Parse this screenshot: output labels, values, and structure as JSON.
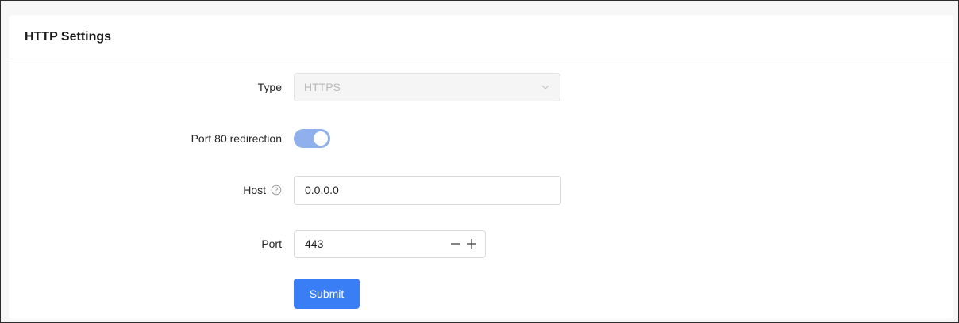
{
  "card": {
    "title": "HTTP Settings"
  },
  "form": {
    "type": {
      "label": "Type",
      "value": "HTTPS",
      "disabled": true
    },
    "redirection": {
      "label": "Port 80 redirection",
      "enabled": true
    },
    "host": {
      "label": "Host",
      "value": "0.0.0.0",
      "help_icon": "question-circle-icon"
    },
    "port": {
      "label": "Port",
      "value": "443",
      "decrement_icon": "minus-icon",
      "increment_icon": "plus-icon"
    },
    "submit_label": "Submit"
  },
  "colors": {
    "primary": "#3a7ef6",
    "toggle_on": "#8fb0ec"
  }
}
